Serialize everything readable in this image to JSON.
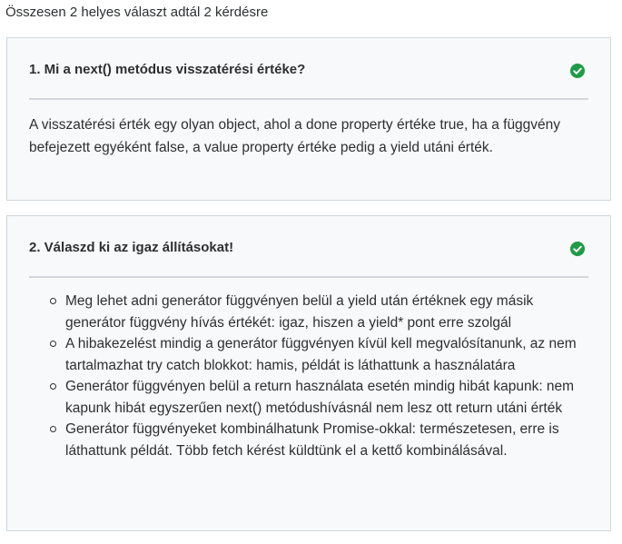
{
  "summary": "Összesen 2 helyes választ adtál 2 kérdésre",
  "colors": {
    "correct": "#1e9b47",
    "card_background": "#f7f9fa",
    "border": "#d1d7dc"
  },
  "questions": [
    {
      "title": "1. Mi a next() metódus visszatérési értéke?",
      "status_icon": "check-circle-icon",
      "answer": "A visszatérési érték egy olyan object, ahol a done property értéke true, ha a függvény befejezett egyéként false, a value property értéke pedig a yield utáni érték."
    },
    {
      "title": "2. Válaszd ki az igaz állításokat!",
      "status_icon": "check-circle-icon",
      "answers": [
        "Meg lehet adni generátor függvényen belül a yield után értéknek egy másik generátor függvény hívás értékét: igaz, hiszen a yield* pont erre szolgál",
        "A hibakezelést mindig a generátor függvényen kívül kell megvalósítanunk, az nem tartalmazhat try catch blokkot: hamis, példát is láthattunk a használatára",
        "Generátor függvényen belül a return használata esetén mindig hibát kapunk: nem kapunk hibát egyszerűen next() metódushívásnál nem lesz ott return utáni érték",
        "Generátor függvényeket kombinálhatunk Promise-okkal: természetesen, erre is láthattunk példát. Több fetch kérést küldtünk el a kettő kombinálásával."
      ]
    }
  ]
}
